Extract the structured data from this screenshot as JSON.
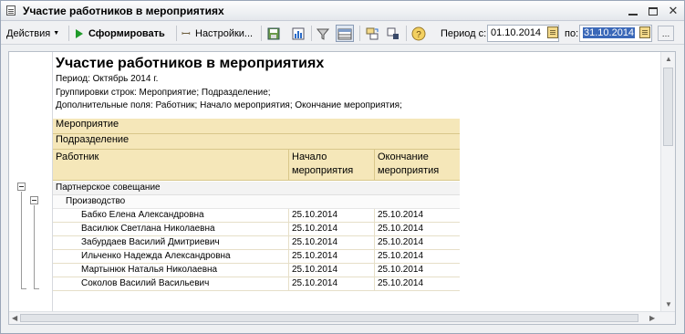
{
  "window": {
    "title": "Участие работников в мероприятиях"
  },
  "toolbar": {
    "actions_label": "Действия",
    "generate_label": "Сформировать",
    "settings_label": "Настройки...",
    "period_from_label": "Период с:",
    "period_from_value": "01.10.2014",
    "period_to_label": "по:",
    "period_to_value": "31.10.2014"
  },
  "report": {
    "title": "Участие работников в мероприятиях",
    "period_line": "Период: Октябрь 2014 г.",
    "grouping_line": "Группировки строк: Мероприятие; Подразделение;",
    "fields_line": "Дополнительные поля: Работник; Начало мероприятия; Окончание мероприятия;",
    "headers": {
      "event": "Мероприятие",
      "department": "Подразделение",
      "employee": "Работник",
      "start_line1": "Начало",
      "start_line2": "мероприятия",
      "end_line1": "Окончание",
      "end_line2": "мероприятия"
    },
    "group_event": "Партнерское совещание",
    "group_department": "Производство",
    "rows": [
      {
        "employee": "Бабко Елена Александровна",
        "start": "25.10.2014",
        "end": "25.10.2014"
      },
      {
        "employee": "Василюк Светлана Николаевна",
        "start": "25.10.2014",
        "end": "25.10.2014"
      },
      {
        "employee": "Забурдаев Василий Дмитриевич",
        "start": "25.10.2014",
        "end": "25.10.2014"
      },
      {
        "employee": "Ильченко Надежда Александровна",
        "start": "25.10.2014",
        "end": "25.10.2014"
      },
      {
        "employee": "Мартынюк Наталья Николаевна",
        "start": "25.10.2014",
        "end": "25.10.2014"
      },
      {
        "employee": "Соколов Василий Васильевич",
        "start": "25.10.2014",
        "end": "25.10.2014"
      }
    ]
  }
}
